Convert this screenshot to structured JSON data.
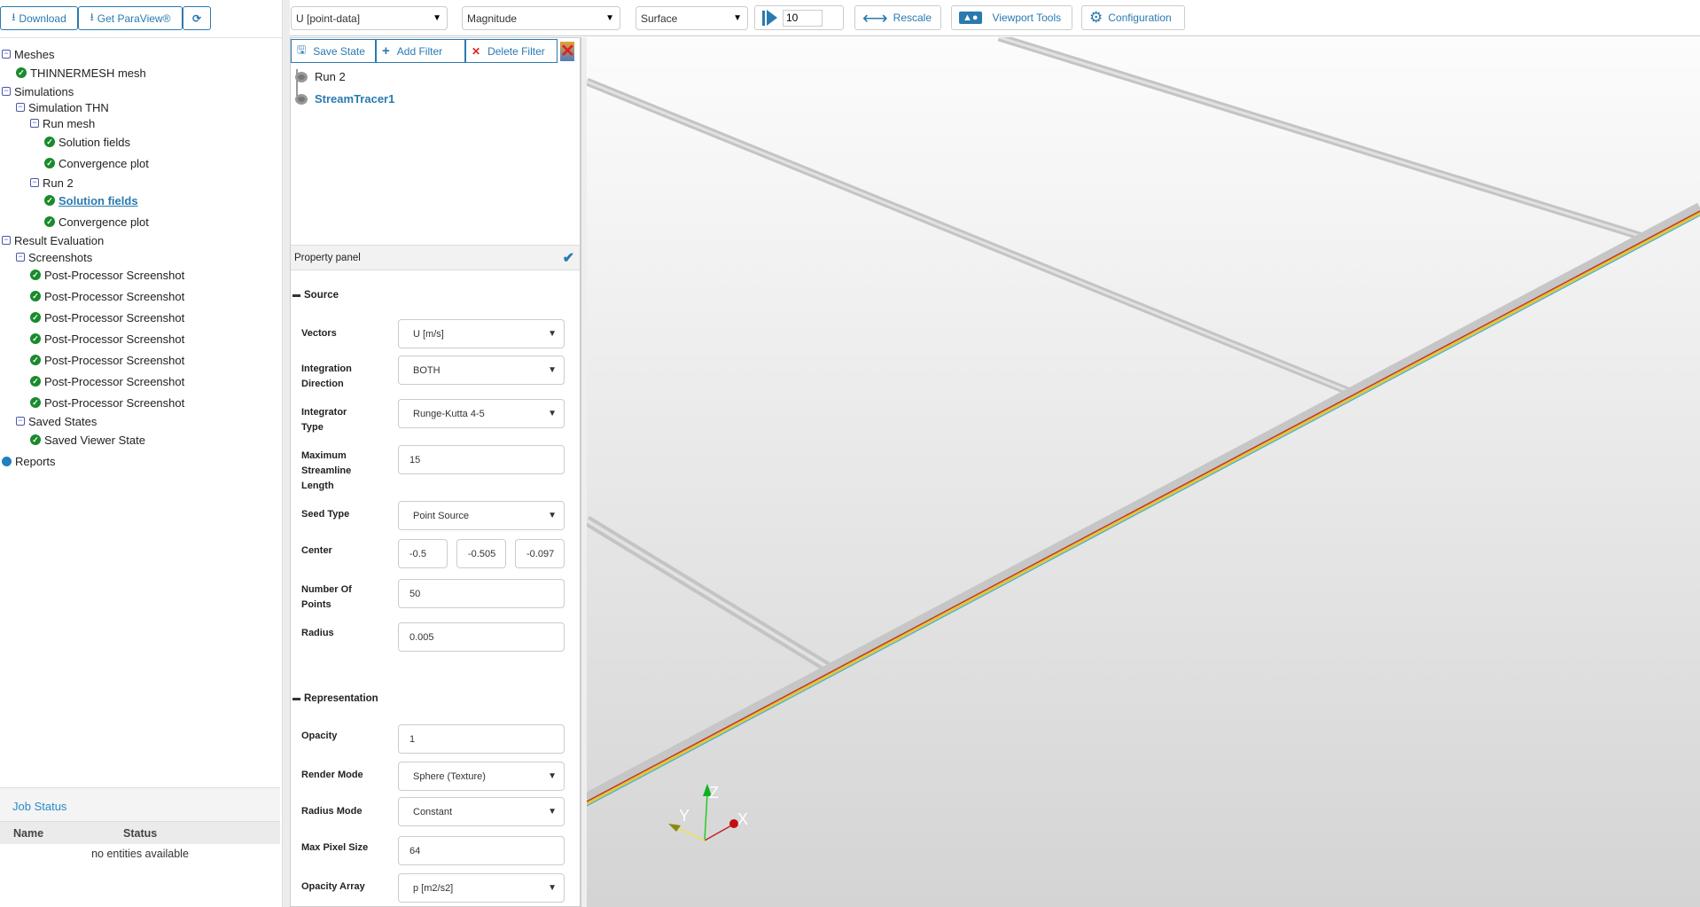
{
  "toolbar_left": {
    "download": "Download",
    "get_paraview": "Get ParaView®"
  },
  "toolbar": {
    "field": "U [point-data]",
    "component": "Magnitude",
    "representation": "Surface",
    "frame": "10",
    "rescale": "Rescale",
    "viewport_tools": "Viewport Tools",
    "configuration": "Configuration"
  },
  "tree": {
    "meshes": "Meshes",
    "mesh1": "THINNERMESH mesh",
    "simulations": "Simulations",
    "sim1": "Simulation THN",
    "run_mesh": "Run mesh",
    "solution_fields": "Solution fields",
    "convergence_plot": "Convergence plot",
    "run2": "Run 2",
    "result_evaluation": "Result Evaluation",
    "screenshots": "Screenshots",
    "screenshot_items": [
      "Post-Processor Screenshot",
      "Post-Processor Screenshot",
      "Post-Processor Screenshot",
      "Post-Processor Screenshot",
      "Post-Processor Screenshot",
      "Post-Processor Screenshot",
      "Post-Processor Screenshot"
    ],
    "saved_states": "Saved States",
    "saved_viewer_state": "Saved Viewer State",
    "reports": "Reports"
  },
  "job_status": {
    "title": "Job Status",
    "col_name": "Name",
    "col_status": "Status",
    "empty": "no entities available"
  },
  "filters": {
    "save_state": "Save State",
    "add_filter": "Add Filter",
    "delete_filter": "Delete Filter"
  },
  "pipeline": [
    "Run 2",
    "StreamTracer1"
  ],
  "property_panel": {
    "title": "Property panel",
    "source": "Source",
    "representation": "Representation",
    "vectors_label": "Vectors",
    "vectors": "U [m/s]",
    "integration_direction_label": "Integration Direction",
    "integration_direction": "BOTH",
    "integrator_type_label": "Integrator Type",
    "integrator_type": "Runge-Kutta 4-5",
    "max_length_label": "Maximum Streamline Length",
    "max_length": "15",
    "seed_type_label": "Seed Type",
    "seed_type": "Point Source",
    "center_label": "Center",
    "center": [
      "-0.5",
      "-0.505",
      "-0.097"
    ],
    "num_points_label": "Number Of Points",
    "num_points": "50",
    "radius_label": "Radius",
    "radius": "0.005",
    "opacity_label": "Opacity",
    "opacity": "1",
    "render_mode_label": "Render Mode",
    "render_mode": "Sphere (Texture)",
    "radius_mode_label": "Radius Mode",
    "radius_mode": "Constant",
    "max_pixel_label": "Max Pixel Size",
    "max_pixel": "64",
    "opacity_array_label": "Opacity Array",
    "opacity_array": "p [m2/s2]"
  },
  "axes": {
    "x": "X",
    "y": "Y",
    "z": "Z"
  },
  "colors": {
    "accent": "#2a7ab0",
    "check": "#1a8a2a"
  }
}
